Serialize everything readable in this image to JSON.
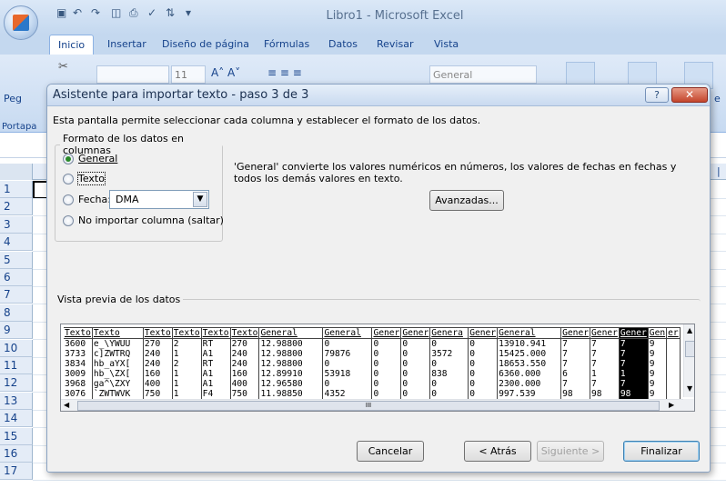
{
  "window": {
    "title": "Libro1 - Microsoft Excel"
  },
  "ribbon": {
    "tabs": [
      "Inicio",
      "Insertar",
      "Diseño de página",
      "Fórmulas",
      "Datos",
      "Revisar",
      "Vista"
    ],
    "font_size": "11",
    "number_format": "General",
    "paste_label": "Peg",
    "clipboard_group": "Portapa",
    "cell_tail": "e"
  },
  "sheet": {
    "rows": [
      "1",
      "2",
      "3",
      "4",
      "5",
      "6",
      "7",
      "8",
      "9",
      "10",
      "11",
      "12",
      "13",
      "14",
      "15",
      "16",
      "17"
    ]
  },
  "dialog": {
    "title": "Asistente para importar texto - paso 3 de 3",
    "help_label": "?",
    "close_label": "✕",
    "intro": "Esta pantalla permite seleccionar cada columna y establecer el formato de los datos.",
    "format_group": "Formato de los datos en columnas",
    "radio_general": "General",
    "radio_texto": "Texto",
    "radio_fecha": "Fecha:",
    "date_format": "DMA",
    "radio_skip": "No importar columna (saltar)",
    "description": "'General' convierte los valores numéricos en números, los valores de fechas en fechas y todos los demás valores en texto.",
    "advanced_button": "Avanzadas...",
    "preview_label": "Vista previa de los datos",
    "cancel_button": "Cancelar",
    "back_button": "< Atrás",
    "next_button": "Siguiente >",
    "finish_button": "Finalizar",
    "h_scroll_mark": "III"
  },
  "preview": {
    "headers": [
      "Texto",
      "Texto",
      "Texto",
      "Texto",
      "Texto",
      "Texto",
      "General",
      "General",
      "Gener",
      "Gener",
      "Genera",
      "Gener",
      "General",
      "Gener",
      "Gener",
      "Gener",
      "Gen",
      "er"
    ],
    "rows": [
      [
        "3600",
        "e_\\YWUU",
        "270",
        "2",
        "RT",
        "270",
        "12.98800",
        "0",
        "0",
        "0",
        "0",
        "0",
        "13910.941",
        "7",
        "7",
        "7",
        "9",
        ""
      ],
      [
        "3733",
        "c]ZWTRQ",
        "240",
        "1",
        "A1",
        "240",
        "12.98800",
        "79876",
        "0",
        "0",
        "3572",
        "0",
        "15425.000",
        "7",
        "7",
        "7",
        "9",
        ""
      ],
      [
        "3834",
        "hb_aYX[",
        "240",
        "2",
        "RT",
        "240",
        "12.98800",
        "0",
        "0",
        "0",
        "0",
        "0",
        "18653.550",
        "7",
        "7",
        "7",
        "9",
        ""
      ],
      [
        "3009",
        "hb_\\ZX[",
        "160",
        "1",
        "A1",
        "160",
        "12.89910",
        "53918",
        "0",
        "0",
        "838",
        "0",
        "6360.000",
        "6",
        "1",
        "1",
        "9",
        ""
      ],
      [
        "3968",
        "ga^\\ZXY",
        "400",
        "1",
        "A1",
        "400",
        "12.96580",
        "0",
        "0",
        "0",
        "0",
        "0",
        "2300.000",
        "7",
        "7",
        "7",
        "9",
        ""
      ],
      [
        "3076",
        "`ZWTWVK",
        "750",
        "1",
        "F4",
        "750",
        "11.98850",
        "4352",
        "0",
        "0",
        "0",
        "0",
        "997.539",
        "98",
        "98",
        "98",
        "9",
        ""
      ]
    ],
    "selected_column": 15
  }
}
